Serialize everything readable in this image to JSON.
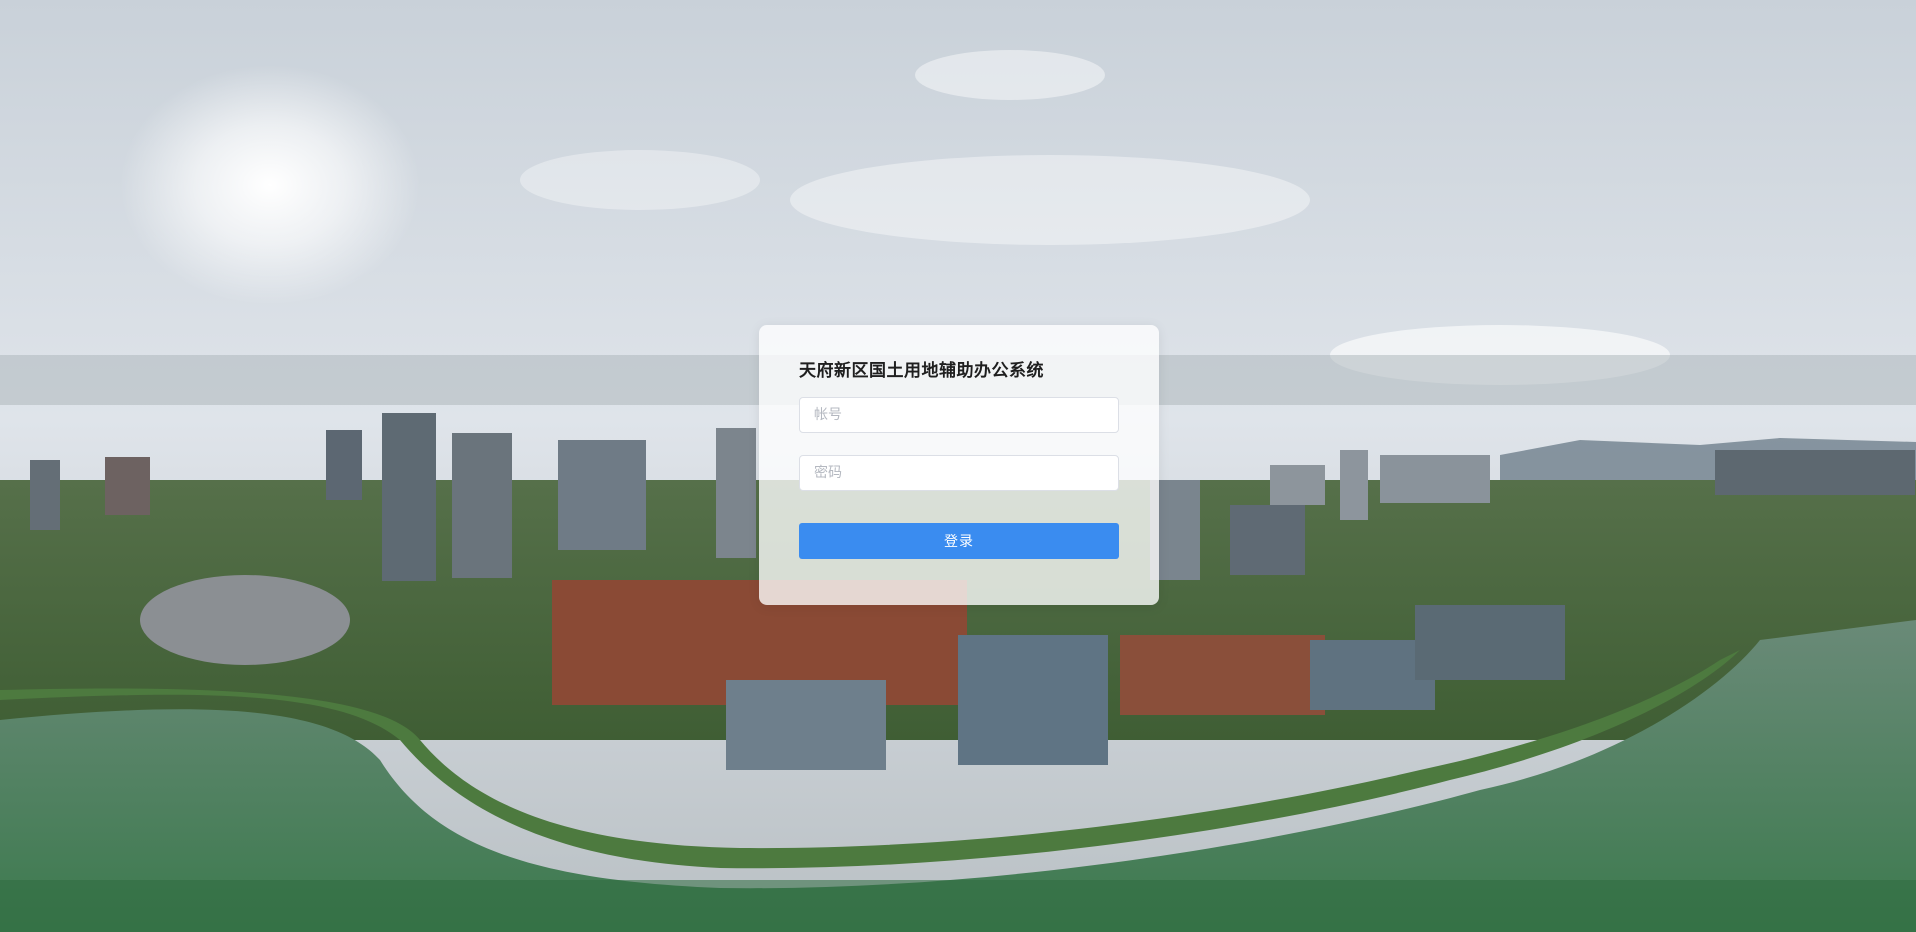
{
  "login": {
    "title": "天府新区国土用地辅助办公系统",
    "username_placeholder": "帐号",
    "password_placeholder": "密码",
    "username_value": "",
    "password_value": "",
    "submit_label": "登录"
  },
  "colors": {
    "accent": "#3a8cf0",
    "card_bg": "#ffffff",
    "title_text": "#1f1f1f"
  },
  "background": {
    "icon": "city-skyline-photo"
  }
}
